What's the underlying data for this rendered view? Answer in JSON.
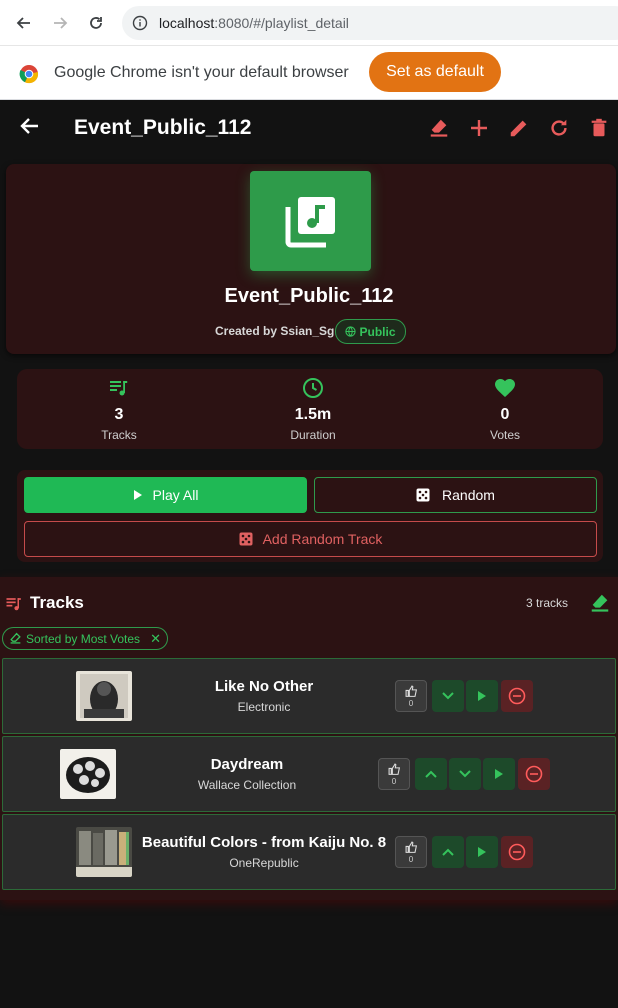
{
  "browser": {
    "url_host": "localhost",
    "url_rest": ":8080/#/playlist_detail",
    "infobar_text": "Google Chrome isn't your default browser",
    "infobar_button": "Set as default"
  },
  "appbar": {
    "title": "Event_Public_112",
    "actions": [
      "sort-icon",
      "add-icon",
      "edit-icon",
      "refresh-icon",
      "delete-icon"
    ]
  },
  "playlist": {
    "name": "Event_Public_112",
    "creator_text": "Created by Ssian_Sg",
    "visibility": "Public"
  },
  "stats": [
    {
      "value": "3",
      "label": "Tracks",
      "icon": "queue-music-icon"
    },
    {
      "value": "1.5m",
      "label": "Duration",
      "icon": "clock-icon"
    },
    {
      "value": "0",
      "label": "Votes",
      "icon": "heart-icon"
    }
  ],
  "actions": {
    "play_all": "Play All",
    "random": "Random",
    "add_random": "Add Random Track"
  },
  "tracks_section": {
    "title": "Tracks",
    "count_text": "3 tracks",
    "sort_chip": "Sorted by Most Votes"
  },
  "tracks": [
    {
      "title": "Like No Other",
      "artist": "Electronic",
      "votes": "0"
    },
    {
      "title": "Daydream",
      "artist": "Wallace Collection",
      "votes": "0"
    },
    {
      "title": "Beautiful Colors - from Kaiju No. 8",
      "artist": "OneRepublic",
      "votes": "0"
    }
  ],
  "colors": {
    "accent_green": "#1fb955",
    "accent_red": "#e06161",
    "card_bg": "#2c1213",
    "chrome_button": "#e27313"
  }
}
